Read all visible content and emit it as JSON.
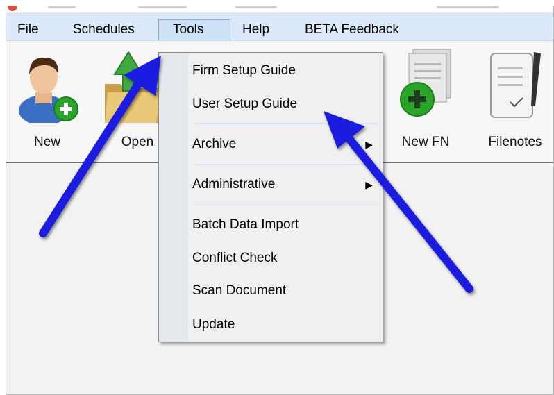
{
  "menubar": {
    "items": [
      {
        "label": "File"
      },
      {
        "label": "Schedules"
      },
      {
        "label": "Tools"
      },
      {
        "label": "Help"
      },
      {
        "label": "BETA Feedback"
      }
    ],
    "active": "Tools"
  },
  "toolbar": {
    "buttons": [
      {
        "label": "New",
        "icon": "user-add-icon"
      },
      {
        "label": "Open",
        "icon": "folder-open-icon"
      },
      {
        "label": "New FN",
        "icon": "new-filenote-icon"
      },
      {
        "label": "Filenotes",
        "icon": "filenotes-icon"
      }
    ]
  },
  "tools_menu": {
    "items": [
      {
        "label": "Firm Setup Guide",
        "submenu": false
      },
      {
        "label": "User Setup Guide",
        "submenu": false
      },
      {
        "label": "Archive",
        "submenu": true
      },
      {
        "label": "Administrative",
        "submenu": true
      },
      {
        "label": "Batch Data Import",
        "submenu": false
      },
      {
        "label": "Conflict Check",
        "submenu": false
      },
      {
        "label": "Scan Document",
        "submenu": false
      },
      {
        "label": "Update",
        "submenu": false
      }
    ]
  },
  "colors": {
    "menubar": "#dbe9fa",
    "annotation_arrow": "#1a1fe0",
    "add_badge": "#2aa52a"
  }
}
